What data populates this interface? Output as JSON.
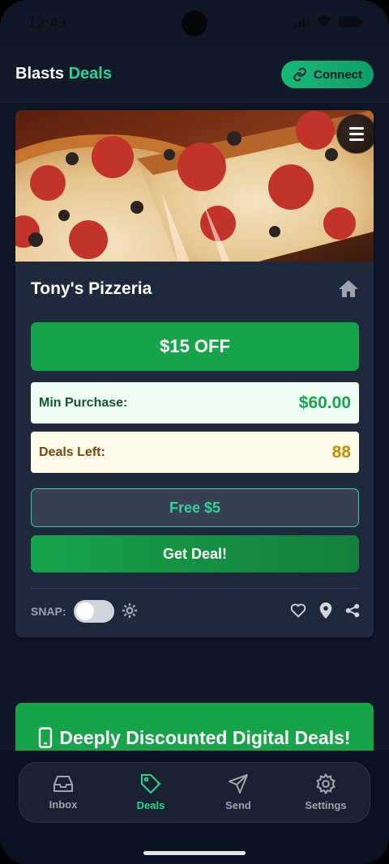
{
  "status_bar": {
    "time": "12:43"
  },
  "header": {
    "brand_part1": "Blasts",
    "brand_part2": "Deals",
    "connect_label": "Connect"
  },
  "deal_card": {
    "restaurant": "Tony's Pizzeria",
    "discount": "$15 OFF",
    "min_purchase_label": "Min Purchase:",
    "min_purchase_value": "$60.00",
    "deals_left_label": "Deals Left:",
    "deals_left_value": "88",
    "free_label": "Free $5",
    "get_deal_label": "Get Deal!",
    "snap_label": "SNAP:",
    "snap_enabled": false
  },
  "promo": {
    "text": "Deeply Discounted Digital Deals!"
  },
  "bottom_nav": [
    {
      "label": "Inbox",
      "icon": "inbox-icon",
      "active": false
    },
    {
      "label": "Deals",
      "icon": "tag-icon",
      "active": true
    },
    {
      "label": "Send",
      "icon": "send-icon",
      "active": false
    },
    {
      "label": "Settings",
      "icon": "gear-icon",
      "active": false
    }
  ],
  "colors": {
    "accent": "#2bd392",
    "primary_green": "#16a34a",
    "background": "#101828",
    "card": "#1e293b"
  }
}
